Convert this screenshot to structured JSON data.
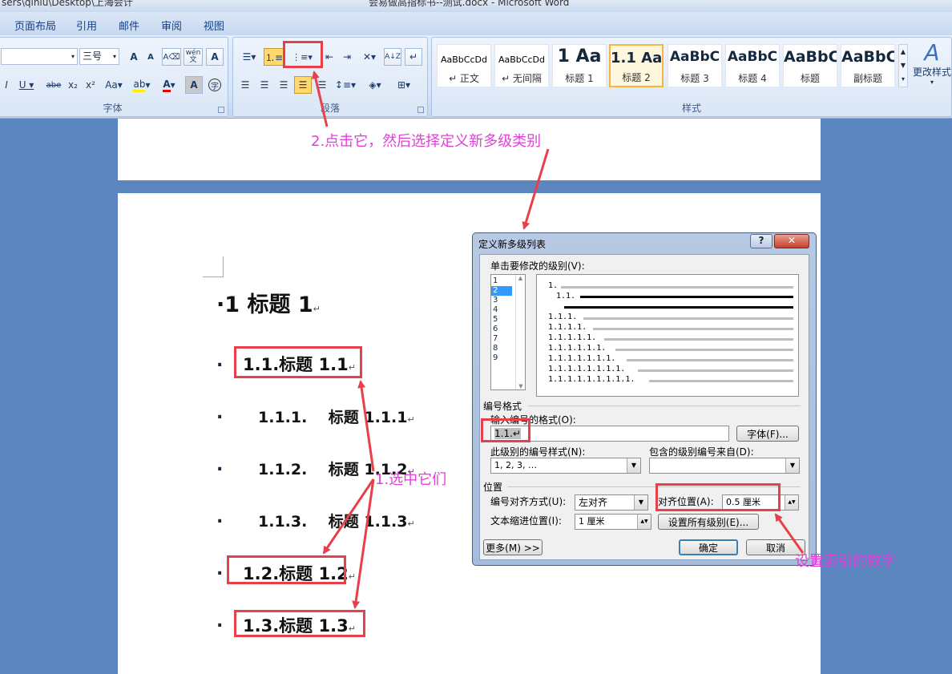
{
  "window": {
    "path_fragment": "sers\\qiniu\\Desktop\\上海会计",
    "doc_title": "会易做高指标书--测试.docx - Microsoft Word"
  },
  "tabs": [
    "页面布局",
    "引用",
    "邮件",
    "审阅",
    "视图"
  ],
  "font_group": {
    "size_value": "三号",
    "label": "字体",
    "buttons": [
      "A",
      "A",
      "Aa",
      "abe",
      "x₂",
      "x²",
      "Aa",
      "A",
      "A"
    ],
    "phonetic": "wén 文"
  },
  "paragraph_group": {
    "label": "段落"
  },
  "styles_group": {
    "label": "样式",
    "styles": [
      {
        "preview": "AaBbCcDd",
        "name": "↵ 正文"
      },
      {
        "preview": "AaBbCcDd",
        "name": "↵ 无间隔"
      },
      {
        "preview": "1  Aa",
        "name": "标题 1"
      },
      {
        "preview": "1.1  Aa",
        "name": "标题 2"
      },
      {
        "preview": "AaBbC",
        "name": "标题 3"
      },
      {
        "preview": "AaBbC",
        "name": "标题 4"
      },
      {
        "preview": "AaBbC",
        "name": "标题"
      },
      {
        "preview": "AaBbC",
        "name": "副标题"
      }
    ],
    "change_styles": "更改样式"
  },
  "document": {
    "h1": "·1  标题 1",
    "items": [
      {
        "text": "1.1.标题 1.1",
        "level": 2
      },
      {
        "text": "1.1.1.    标题 1.1.1",
        "level": 3
      },
      {
        "text": "1.1.2.    标题 1.1.2",
        "level": 3
      },
      {
        "text": "1.1.3.    标题 1.1.3",
        "level": 3
      },
      {
        "text": "1.2.标题 1.2",
        "level": 2
      },
      {
        "text": "1.3.标题 1.3",
        "level": 2
      }
    ],
    "return_mark": "↵",
    "bullet": "."
  },
  "annotations": {
    "step2": "2.点击它，然后选择定义新多级类别",
    "step1": "1.选中它们",
    "step3": "设置索引的数字"
  },
  "dialog": {
    "title": "定义新多级列表",
    "help": "?",
    "close": "✕",
    "click_level_label": "单击要修改的级别(V):",
    "levels": [
      "1",
      "2",
      "3",
      "4",
      "5",
      "6",
      "7",
      "8",
      "9"
    ],
    "selected_level": "2",
    "preview_lines": [
      "1.",
      "1.1.",
      "1.1.1.",
      "1.1.1.1.",
      "1.1.1.1.1.",
      "1.1.1.1.1.1.",
      "1.1.1.1.1.1.1.",
      "1.1.1.1.1.1.1.1.",
      "1.1.1.1.1.1.1.1.1."
    ],
    "number_format_section": "编号格式",
    "enter_format_label": "输入编号的格式(O):",
    "format_value": "1.1.↵",
    "font_button": "字体(F)...",
    "number_style_label": "此级别的编号样式(N):",
    "number_style_value": "1, 2, 3, …",
    "include_level_label": "包含的级别编号来自(D):",
    "include_level_value": "",
    "position_section": "位置",
    "alignment_label": "编号对齐方式(U):",
    "alignment_value": "左对齐",
    "aligned_at_label": "对齐位置(A):",
    "aligned_at_value": "0.5 厘米",
    "indent_label": "文本缩进位置(I):",
    "indent_value": "1 厘米",
    "set_all_button": "设置所有级别(E)...",
    "more_button": "更多(M) >>",
    "ok_button": "确定",
    "cancel_button": "取消"
  }
}
